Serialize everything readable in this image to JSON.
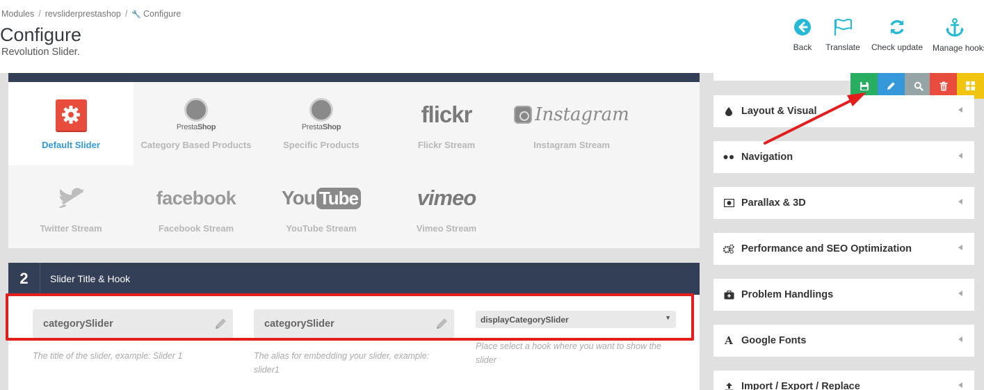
{
  "breadcrumb": {
    "modules": "Modules",
    "module": "revsliderprestashop",
    "current": "Configure",
    "separator": "/",
    "current_icon": "wrench-icon"
  },
  "page": {
    "title": "Configure",
    "subtitle": "Revolution Slider."
  },
  "toolbar": {
    "back": "Back",
    "translate": "Translate",
    "check_update": "Check update",
    "manage_hooks": "Manage hooks",
    "accent_color": "#25b9d7"
  },
  "slider_types": {
    "items": [
      {
        "label": "Default Slider",
        "icon": "gear-icon",
        "active": true
      },
      {
        "label": "Category Based Products",
        "icon": "prestashop-logo",
        "logo_text_a": "Presta",
        "logo_text_b": "Shop"
      },
      {
        "label": "Specific Products",
        "icon": "prestashop-logo",
        "logo_text_a": "Presta",
        "logo_text_b": "Shop"
      },
      {
        "label": "Flickr Stream",
        "icon": "flickr-logo",
        "logo_text": "flickr"
      },
      {
        "label": "Instagram Stream",
        "icon": "instagram-logo",
        "logo_text": "Instagram"
      },
      {
        "label": "Twitter Stream",
        "icon": "twitter-bird-icon"
      },
      {
        "label": "Facebook Stream",
        "icon": "facebook-logo",
        "logo_text": "facebook"
      },
      {
        "label": "YouTube Stream",
        "icon": "youtube-logo",
        "logo_text_a": "You",
        "logo_text_b": "Tube"
      },
      {
        "label": "Vimeo Stream",
        "icon": "vimeo-logo",
        "logo_text": "vimeo"
      }
    ]
  },
  "section2": {
    "number": "2",
    "title": "Slider Title & Hook",
    "title_field": {
      "value": "categorySlider",
      "hint": "The title of the slider, example: Slider 1"
    },
    "alias_field": {
      "value": "categorySlider",
      "hint": "The alias for embedding your slider, example: slider1"
    },
    "hook_select": {
      "value": "displayCategorySlider",
      "hint": "Place select a hook where you want to show the slider"
    }
  },
  "actions": {
    "save": "save-icon",
    "edit": "pencil-icon",
    "preview": "search-icon",
    "delete": "trash-icon",
    "layout": "grid-icon",
    "colors": {
      "save": "#27ae60",
      "edit": "#3498db",
      "preview": "#95a5a6",
      "delete": "#e74c3c",
      "layout": "#f1c40f"
    }
  },
  "side_panels": [
    {
      "label": "Layout & Visual",
      "icon": "droplet-icon"
    },
    {
      "label": "Navigation",
      "icon": "dots-icon"
    },
    {
      "label": "Parallax & 3D",
      "icon": "photo-icon"
    },
    {
      "label": "Performance and SEO Optimization",
      "icon": "cogs-icon"
    },
    {
      "label": "Problem Handlings",
      "icon": "medkit-icon"
    },
    {
      "label": "Google Fonts",
      "icon": "font-icon"
    },
    {
      "label": "Import / Export / Replace",
      "icon": "upload-icon"
    }
  ],
  "annotations": {
    "highlight_color": "#e31c1c"
  }
}
